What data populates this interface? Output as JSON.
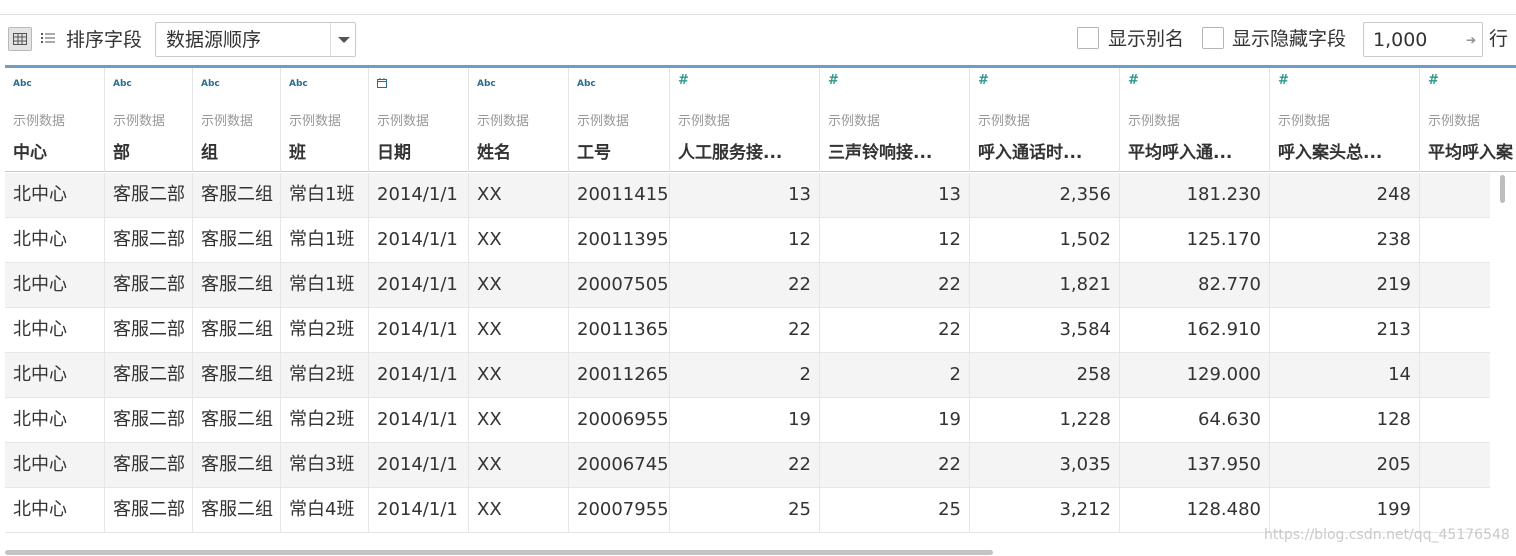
{
  "toolbar": {
    "sort_label": "排序字段",
    "sort_value": "数据源顺序",
    "show_alias_label": "显示别名",
    "show_hidden_label": "显示隐藏字段",
    "rows_value": "1,000",
    "rows_suffix": "行"
  },
  "columns": [
    {
      "type": "Abc",
      "kind": "text",
      "source": "示例数据",
      "name": "中心",
      "align": "left"
    },
    {
      "type": "Abc",
      "kind": "text",
      "source": "示例数据",
      "name": "部",
      "align": "left"
    },
    {
      "type": "Abc",
      "kind": "text",
      "source": "示例数据",
      "name": "组",
      "align": "left"
    },
    {
      "type": "Abc",
      "kind": "text",
      "source": "示例数据",
      "name": "班",
      "align": "left"
    },
    {
      "type": "calendar-icon",
      "kind": "date",
      "source": "示例数据",
      "name": "日期",
      "align": "left"
    },
    {
      "type": "Abc",
      "kind": "text",
      "source": "示例数据",
      "name": "姓名",
      "align": "left"
    },
    {
      "type": "Abc",
      "kind": "text",
      "source": "示例数据",
      "name": "工号",
      "align": "left"
    },
    {
      "type": "#",
      "kind": "num",
      "source": "示例数据",
      "name": "人工服务接...",
      "align": "right"
    },
    {
      "type": "#",
      "kind": "num",
      "source": "示例数据",
      "name": "三声铃响接...",
      "align": "right"
    },
    {
      "type": "#",
      "kind": "num",
      "source": "示例数据",
      "name": "呼入通话时...",
      "align": "right"
    },
    {
      "type": "#",
      "kind": "num",
      "source": "示例数据",
      "name": "平均呼入通...",
      "align": "right"
    },
    {
      "type": "#",
      "kind": "num",
      "source": "示例数据",
      "name": "呼入案头总...",
      "align": "right"
    },
    {
      "type": "#",
      "kind": "num",
      "source": "示例数据",
      "name": "平均呼入案",
      "align": "right"
    }
  ],
  "rows": [
    [
      "北中心",
      "客服二部",
      "客服二组",
      "常白1班",
      "2014/1/1",
      "XX",
      "20011415",
      "13",
      "13",
      "2,356",
      "181.230",
      "248",
      ""
    ],
    [
      "北中心",
      "客服二部",
      "客服二组",
      "常白1班",
      "2014/1/1",
      "XX",
      "20011395",
      "12",
      "12",
      "1,502",
      "125.170",
      "238",
      ""
    ],
    [
      "北中心",
      "客服二部",
      "客服二组",
      "常白1班",
      "2014/1/1",
      "XX",
      "20007505",
      "22",
      "22",
      "1,821",
      "82.770",
      "219",
      ""
    ],
    [
      "北中心",
      "客服二部",
      "客服二组",
      "常白2班",
      "2014/1/1",
      "XX",
      "20011365",
      "22",
      "22",
      "3,584",
      "162.910",
      "213",
      ""
    ],
    [
      "北中心",
      "客服二部",
      "客服二组",
      "常白2班",
      "2014/1/1",
      "XX",
      "20011265",
      "2",
      "2",
      "258",
      "129.000",
      "14",
      ""
    ],
    [
      "北中心",
      "客服二部",
      "客服二组",
      "常白2班",
      "2014/1/1",
      "XX",
      "20006955",
      "19",
      "19",
      "1,228",
      "64.630",
      "128",
      ""
    ],
    [
      "北中心",
      "客服二部",
      "客服二组",
      "常白3班",
      "2014/1/1",
      "XX",
      "20006745",
      "22",
      "22",
      "3,035",
      "137.950",
      "205",
      ""
    ],
    [
      "北中心",
      "客服二部",
      "客服二组",
      "常白4班",
      "2014/1/1",
      "XX",
      "20007955",
      "25",
      "25",
      "3,212",
      "128.480",
      "199",
      ""
    ]
  ],
  "watermark": "https://blog.csdn.net/qq_45176548",
  "colors": {
    "header_accent": "#6d9ec6",
    "type_text": "#2a6d93",
    "type_num": "#2d9a8a"
  }
}
